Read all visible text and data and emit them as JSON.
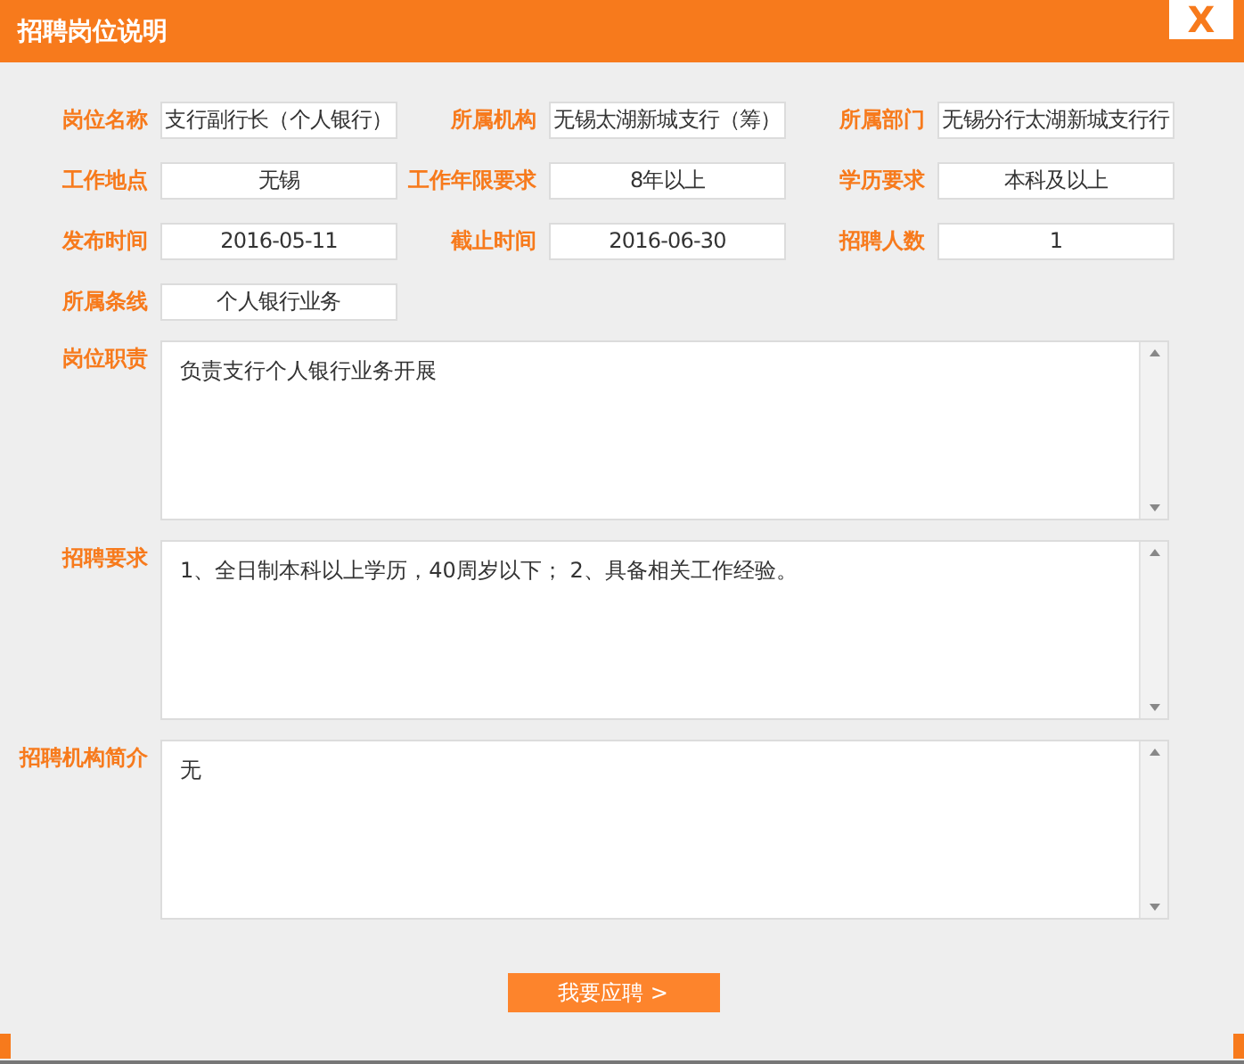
{
  "window": {
    "title": "招聘岗位说明",
    "close": "X"
  },
  "fields": [
    {
      "label": "岗位名称",
      "value": "支行副行长（个人银行）"
    },
    {
      "label": "所属机构",
      "value": "无锡太湖新城支行（筹）"
    },
    {
      "label": "所属部门",
      "value": "无锡分行太湖新城支行行"
    },
    {
      "label": "工作地点",
      "value": "无锡"
    },
    {
      "label": "工作年限要求",
      "value": "8年以上"
    },
    {
      "label": "学历要求",
      "value": "本科及以上"
    },
    {
      "label": "发布时间",
      "value": "2016-05-11"
    },
    {
      "label": "截止时间",
      "value": "2016-06-30"
    },
    {
      "label": "招聘人数",
      "value": "1"
    },
    {
      "label": "所属条线",
      "value": "个人银行业务"
    }
  ],
  "text_areas": [
    {
      "label": "岗位职责",
      "value": "负责支行个人银行业务开展"
    },
    {
      "label": "招聘要求",
      "value": "1、全日制本科以上学历，40周岁以下； 2、具备相关工作经验。"
    },
    {
      "label": "招聘机构简介",
      "value": "无"
    }
  ],
  "apply_button": "我要应聘 >"
}
